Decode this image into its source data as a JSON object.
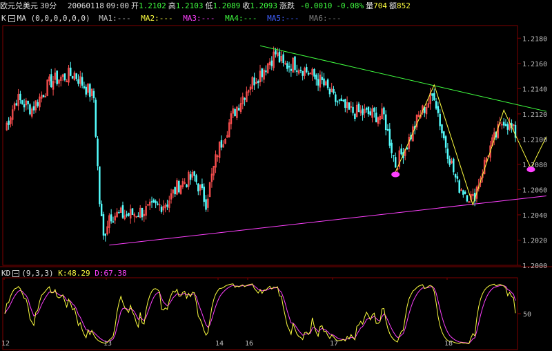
{
  "title_bar": {
    "instrument": "欧元兑美元",
    "period": "30分",
    "date": "20060118",
    "time": "09:00",
    "open_label": "开",
    "open": "1.2102",
    "high_label": "高",
    "high": "1.2103",
    "low_label": "低",
    "low": "1.2089",
    "close_label": "收",
    "close": "1.2093",
    "change_label": "涨跌",
    "change": "-0.0010",
    "change_pct": "-0.08%",
    "volume_label": "量",
    "volume": "704",
    "amount_label": "额",
    "amount": "852"
  },
  "ma_bar": {
    "k_label": "K",
    "indicator": "MA",
    "params": "(0,0,0,0,0,0)",
    "ma1": "MA1:---",
    "ma2": "MA2:---",
    "ma3": "MA3:---",
    "ma4": "MA4:---",
    "ma5": "MA5:---",
    "ma6": "MA6:---"
  },
  "kd_bar": {
    "indicator": "KD",
    "params": "(9,3,3)",
    "k": "K:48.29",
    "d": "D:67.38"
  },
  "colors": {
    "up": "#ff5050",
    "down": "#54ffff",
    "k_line": "#ffff40",
    "d_line": "#ff40ff",
    "ma1": "#c0c0c0",
    "ma2": "#ffff40",
    "ma3": "#ff40ff",
    "ma4": "#40ff40",
    "ma5": "#4060ff",
    "ma6": "#808080",
    "grid": "#800000",
    "green": "#40ff40",
    "pink": "#ff40ff",
    "yellow": "#ffff40"
  },
  "price_axis": {
    "min": 1.2,
    "max": 1.219,
    "labels": [
      "1.2180",
      "1.2160",
      "1.2140",
      "1.2120",
      "1.2100",
      "1.2080",
      "1.2060",
      "1.2040",
      "1.2020",
      "1.2000"
    ]
  },
  "kd_axis": {
    "labels": [
      "50"
    ]
  },
  "time_axis": {
    "labels": [
      "12",
      "13",
      "14",
      "16",
      "17",
      "18"
    ]
  },
  "chart_data": {
    "type": "candlestick",
    "keypoints": [
      [
        0,
        1.2108
      ],
      [
        6,
        1.2132
      ],
      [
        14,
        1.2124
      ],
      [
        24,
        1.2146
      ],
      [
        36,
        1.2152
      ],
      [
        46,
        1.2133
      ],
      [
        49,
        1.205
      ],
      [
        51,
        1.2022
      ],
      [
        54,
        1.204
      ],
      [
        64,
        1.204
      ],
      [
        74,
        1.2044
      ],
      [
        84,
        1.205
      ],
      [
        90,
        1.2064
      ],
      [
        98,
        1.207
      ],
      [
        104,
        1.205
      ],
      [
        110,
        1.209
      ],
      [
        118,
        1.212
      ],
      [
        126,
        1.2142
      ],
      [
        134,
        1.2156
      ],
      [
        140,
        1.2168
      ],
      [
        144,
        1.2158
      ],
      [
        150,
        1.216
      ],
      [
        156,
        1.2154
      ],
      [
        164,
        1.2145
      ],
      [
        170,
        1.2132
      ],
      [
        178,
        1.2122
      ],
      [
        188,
        1.212
      ],
      [
        196,
        1.2118
      ],
      [
        202,
        1.208
      ],
      [
        208,
        1.2096
      ],
      [
        214,
        1.2118
      ],
      [
        222,
        1.2136
      ],
      [
        226,
        1.2106
      ],
      [
        234,
        1.2064
      ],
      [
        242,
        1.2052
      ],
      [
        250,
        1.209
      ],
      [
        258,
        1.2116
      ],
      [
        264,
        1.2104
      ]
    ],
    "drawings": {
      "green_trendline": [
        [
          132,
          1.2174
        ],
        [
          280,
          1.2122
        ]
      ],
      "pink_trendline": [
        [
          54,
          1.2016
        ],
        [
          280,
          1.2055
        ]
      ],
      "zigzag": [
        [
          202,
          1.2074
        ],
        [
          222,
          1.2143
        ],
        [
          242,
          1.2048
        ],
        [
          258,
          1.2123
        ],
        [
          272,
          1.2077
        ],
        [
          280,
          1.2102
        ]
      ],
      "markers": [
        [
          202,
          1.2072
        ],
        [
          272,
          1.2076
        ]
      ]
    },
    "kd_scale": [
      0,
      100
    ],
    "bar_count": 264
  }
}
